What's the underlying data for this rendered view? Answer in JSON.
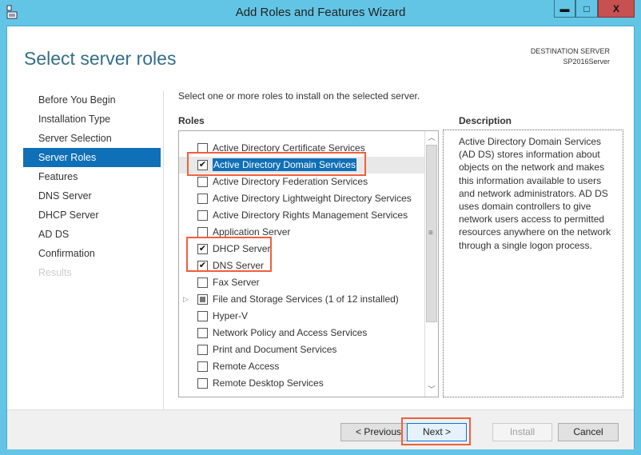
{
  "window": {
    "title": "Add Roles and Features Wizard",
    "icon": "server-manager-icon",
    "controls": {
      "minimize": "▬",
      "maximize": "□",
      "close": "X"
    }
  },
  "header": {
    "page_title": "Select server roles",
    "destination_label": "DESTINATION SERVER",
    "destination_value": "SP2016Server"
  },
  "nav": {
    "items": [
      {
        "label": "Before You Begin",
        "state": "normal"
      },
      {
        "label": "Installation Type",
        "state": "normal"
      },
      {
        "label": "Server Selection",
        "state": "normal"
      },
      {
        "label": "Server Roles",
        "state": "active"
      },
      {
        "label": "Features",
        "state": "normal"
      },
      {
        "label": "DNS Server",
        "state": "normal"
      },
      {
        "label": "DHCP Server",
        "state": "normal"
      },
      {
        "label": "AD DS",
        "state": "normal"
      },
      {
        "label": "Confirmation",
        "state": "normal"
      },
      {
        "label": "Results",
        "state": "disabled"
      }
    ]
  },
  "main": {
    "intro": "Select one or more roles to install on the selected server.",
    "roles_heading": "Roles",
    "roles": [
      {
        "label": "Active Directory Certificate Services",
        "checked": false
      },
      {
        "label": "Active Directory Domain Services",
        "checked": true,
        "selected": true
      },
      {
        "label": "Active Directory Federation Services",
        "checked": false
      },
      {
        "label": "Active Directory Lightweight Directory Services",
        "checked": false
      },
      {
        "label": "Active Directory Rights Management Services",
        "checked": false
      },
      {
        "label": "Application Server",
        "checked": false
      },
      {
        "label": "DHCP Server",
        "checked": true
      },
      {
        "label": "DNS Server",
        "checked": true
      },
      {
        "label": "Fax Server",
        "checked": false
      },
      {
        "label": "File and Storage Services (1 of 12 installed)",
        "checked": "partial",
        "expandable": true
      },
      {
        "label": "Hyper-V",
        "checked": false
      },
      {
        "label": "Network Policy and Access Services",
        "checked": false
      },
      {
        "label": "Print and Document Services",
        "checked": false
      },
      {
        "label": "Remote Access",
        "checked": false
      },
      {
        "label": "Remote Desktop Services",
        "checked": false
      }
    ],
    "description_heading": "Description",
    "description": "Active Directory Domain Services (AD DS) stores information about objects on the network and makes this information available to users and network administrators. AD DS uses domain controllers to give network users access to permitted resources anywhere on the network through a single logon process."
  },
  "footer": {
    "previous": "< Previous",
    "next": "Next >",
    "install": "Install",
    "cancel": "Cancel"
  },
  "colors": {
    "title_bar": "#62c5e6",
    "accent": "#0f6fb7",
    "page_title": "#336f86",
    "close": "#c75050",
    "annotation": "#ef5f3c"
  }
}
